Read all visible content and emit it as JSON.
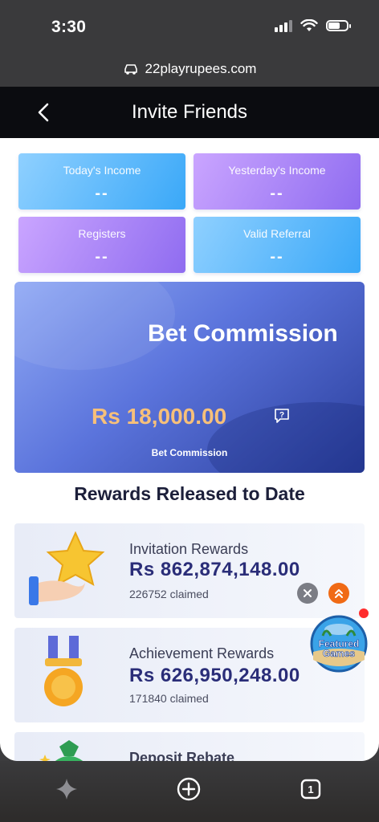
{
  "status_bar": {
    "time": "3:30"
  },
  "browser": {
    "url": "22playrupees.com"
  },
  "header": {
    "title": "Invite Friends"
  },
  "stats": [
    {
      "label": "Today's Income",
      "value": "--"
    },
    {
      "label": "Yesterday's Income",
      "value": "--"
    },
    {
      "label": "Registers",
      "value": "--"
    },
    {
      "label": "Valid Referral",
      "value": "--"
    }
  ],
  "commission": {
    "title": "Bet Commission",
    "amount": "Rs 18,000.00",
    "subtitle": "Bet Commission"
  },
  "rewards_heading": "Rewards Released to Date",
  "rewards": [
    {
      "title": "Invitation Rewards",
      "amount": "Rs 862,874,148.00",
      "claimed": "226752 claimed"
    },
    {
      "title": "Achievement Rewards",
      "amount": "Rs 626,950,248.00",
      "claimed": "171840 claimed"
    },
    {
      "title": "Deposit Rebate"
    }
  ],
  "featured_badge": {
    "label_line1": "Featured",
    "label_line2": "Games"
  },
  "toolbar": {
    "tabs_count": "1"
  },
  "colors": {
    "header_bg": "#0b0c10",
    "accent_amount": "#2a2d78",
    "commission_amount": "#f7c07a",
    "scroll_top_button": "#f06a15"
  }
}
